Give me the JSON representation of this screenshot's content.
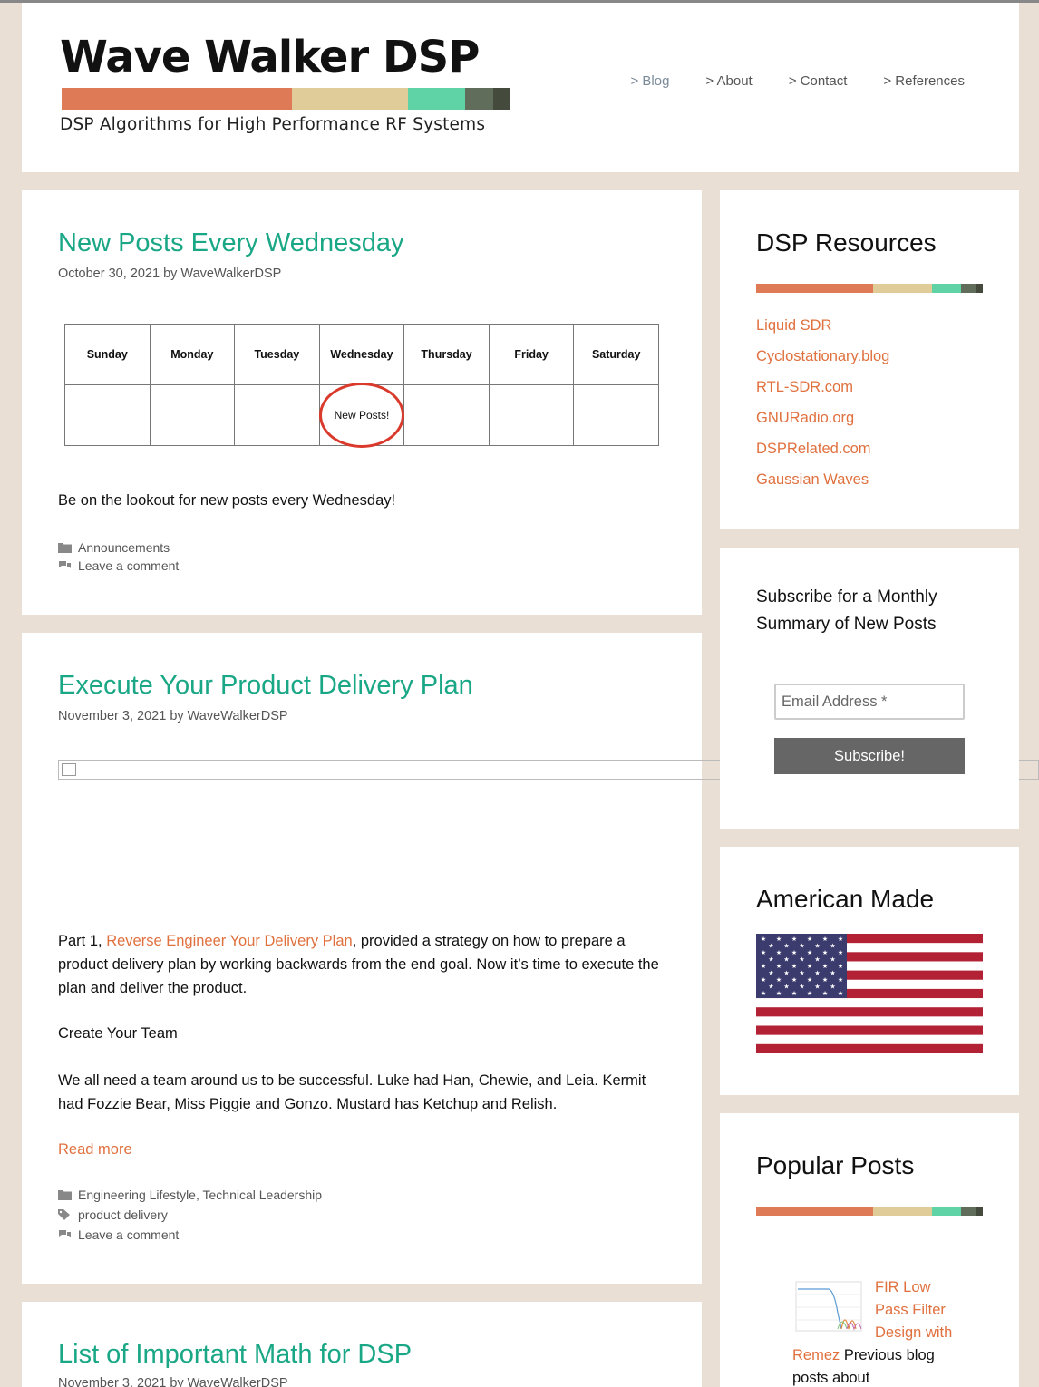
{
  "site": {
    "title": "Wave Walker DSP",
    "tagline": "DSP Algorithms for High Performance RF Systems",
    "brand_colors": [
      "#df7a56",
      "#e0cc98",
      "#5fd3a6",
      "#606d5a",
      "#444a3c"
    ]
  },
  "nav": {
    "items": [
      {
        "label": "> Blog"
      },
      {
        "label": "> About"
      },
      {
        "label": "> Contact"
      },
      {
        "label": "> References"
      }
    ]
  },
  "posts": [
    {
      "title": "New Posts Every Wednesday",
      "meta": "October 30, 2021 by WaveWalkerDSP",
      "calendar": {
        "days": [
          "Sunday",
          "Monday",
          "Tuesday",
          "Wednesday",
          "Thursday",
          "Friday",
          "Saturday"
        ],
        "highlight_text": "New Posts!"
      },
      "body": "Be on the lookout for new posts every Wednesday!",
      "categories": "Announcements",
      "comment_link": "Leave a comment"
    },
    {
      "title": "Execute Your Product Delivery Plan",
      "meta": "November 3, 2021 by WaveWalkerDSP",
      "p1_prefix": "Part 1, ",
      "p1_link": "Reverse Engineer Your Delivery Plan",
      "p1_suffix": ", provided a strategy on how to prepare a product delivery plan by working backwards from the end goal. Now it’s time to execute the plan and deliver the product.",
      "p2": "Create Your Team",
      "p3": "We all need a team around us to be successful. Luke had Han, Chewie, and Leia. Kermit had Fozzie Bear, Miss Piggie and Gonzo. Mustard has Ketchup and Relish.",
      "read_more": "Read more",
      "categories": "Engineering Lifestyle, Technical Leadership",
      "tags": "product delivery",
      "comment_link": "Leave a comment"
    },
    {
      "title": "List of Important Math for DSP",
      "meta": "November 3, 2021 by WaveWalkerDSP"
    }
  ],
  "sidebar": {
    "resources": {
      "title": "DSP Resources",
      "links": [
        "Liquid SDR",
        "Cyclostationary.blog",
        "RTL-SDR.com",
        "GNURadio.org",
        "DSPRelated.com",
        "Gaussian Waves"
      ]
    },
    "subscribe": {
      "title": "Subscribe for a Monthly Summary of New Posts",
      "email_placeholder": "Email Address *",
      "button": "Subscribe!"
    },
    "american": {
      "title": "American Made"
    },
    "popular": {
      "title": "Popular Posts",
      "item_link": "FIR Low Pass Filter Design with Remez",
      "item_text": " Previous blog posts about"
    }
  }
}
